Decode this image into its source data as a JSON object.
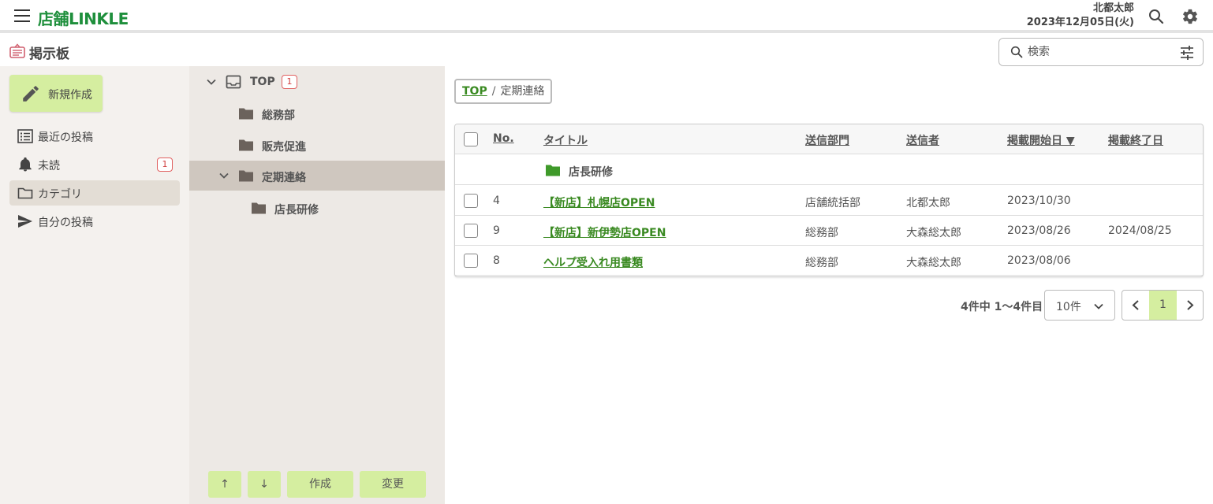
{
  "header": {
    "logo": "店舗LINKLE",
    "user_name": "北都太郎",
    "date": "2023年12月05日(火)",
    "icons": [
      "menu-icon",
      "search-icon",
      "gear-icon"
    ]
  },
  "page": {
    "title": "掲示板",
    "search_placeholder": "検索"
  },
  "sidebar": {
    "new_button": "新規作成",
    "items": [
      {
        "label": "最近の投稿",
        "icon": "list-icon"
      },
      {
        "label": "未読",
        "icon": "bell-icon",
        "badge": "1"
      },
      {
        "label": "カテゴリ",
        "icon": "folder-icon",
        "active": true
      },
      {
        "label": "自分の投稿",
        "icon": "send-icon"
      }
    ]
  },
  "tree": {
    "nodes": [
      {
        "label": "TOP",
        "badge": "1"
      },
      {
        "label": "総務部"
      },
      {
        "label": "販売促進"
      },
      {
        "label": "定期連絡",
        "selected": true
      },
      {
        "label": "店長研修"
      }
    ],
    "buttons": {
      "up": "↑",
      "down": "↓",
      "create": "作成",
      "change": "変更"
    }
  },
  "main": {
    "breadcrumb": {
      "root": "TOP",
      "sep": "/",
      "current": "定期連絡"
    },
    "columns": {
      "no": "No.",
      "title": "タイトル",
      "dept": "送信部門",
      "sender": "送信者",
      "start": "掲載開始日 ▼",
      "end": "掲載終了日"
    },
    "folder_row": "店長研修",
    "rows": [
      {
        "no": "4",
        "title": "【新店】札幌店OPEN",
        "dept": "店舗統括部",
        "sender": "北都太郎",
        "start": "2023/10/30",
        "end": ""
      },
      {
        "no": "9",
        "title": "【新店】新伊勢店OPEN",
        "dept": "総務部",
        "sender": "大森総太郎",
        "start": "2023/08/26",
        "end": "2024/08/25"
      },
      {
        "no": "8",
        "title": "ヘルプ受入れ用書類",
        "dept": "総務部",
        "sender": "大森総太郎",
        "start": "2023/08/06",
        "end": ""
      }
    ],
    "count_text": "4件中 1〜4件目",
    "per_page": "10件",
    "current_page": "1"
  },
  "colors": {
    "accent_green": "#d5eea0",
    "link_green": "#3a8a22",
    "logo_green": "#1e8f3c",
    "badge_red": "#e06060"
  }
}
